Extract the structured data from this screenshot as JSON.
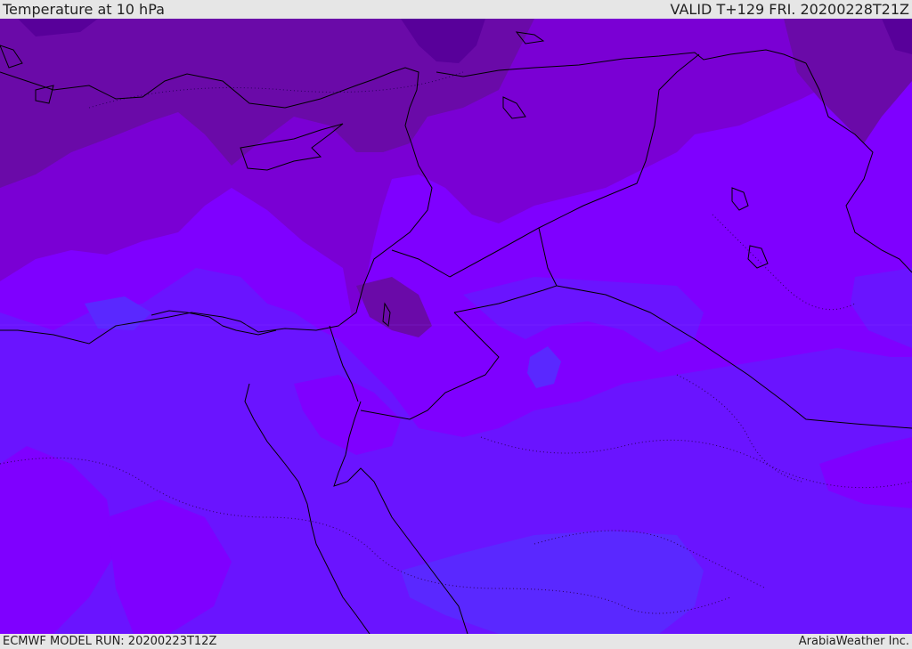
{
  "header": {
    "title": "Temperature at 10 hPa",
    "valid": "VALID T+129 FRI. 20200228T21Z"
  },
  "footer": {
    "model_run": "ECMWF MODEL RUN: 20200223T12Z",
    "credit": "ArabiaWeather Inc."
  },
  "map": {
    "colors": {
      "band_darkest": "#58009a",
      "band_dark": "#6a0aa8",
      "band_mid": "#7a00d4",
      "band_violet": "#7f00ff",
      "band_blue_violet": "#6a14ff",
      "band_blue": "#5a28ff",
      "coast": "#000000"
    }
  }
}
